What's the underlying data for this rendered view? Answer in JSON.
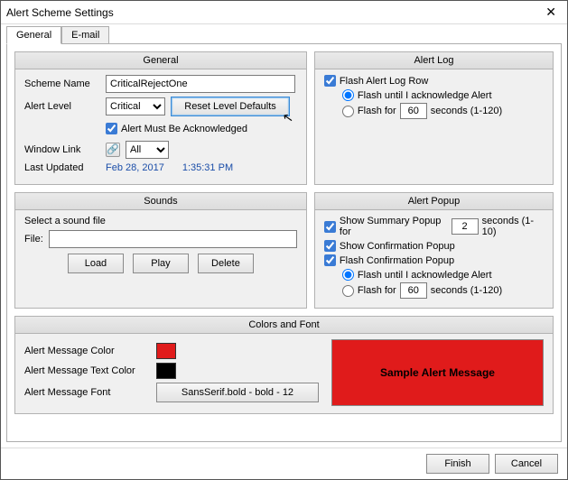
{
  "window": {
    "title": "Alert Scheme Settings"
  },
  "tabs": {
    "general": "General",
    "email": "E-mail"
  },
  "general": {
    "title": "General",
    "scheme_label": "Scheme Name",
    "scheme_value": "CriticalRejectOne",
    "level_label": "Alert Level",
    "level_value": "Critical",
    "reset_label": "Reset Level Defaults",
    "must_ack": "Alert Must Be Acknowledged",
    "window_link": "Window Link",
    "window_link_value": "All",
    "last_updated_label": "Last Updated",
    "last_updated_date": "Feb 28, 2017",
    "last_updated_time": "1:35:31 PM"
  },
  "alertlog": {
    "title": "Alert Log",
    "flash_row": "Flash Alert Log Row",
    "until_ack": "Flash until I acknowledge Alert",
    "flash_for_a": "Flash for",
    "flash_for_val": "60",
    "flash_for_b": "seconds (1-120)"
  },
  "sounds": {
    "title": "Sounds",
    "select": "Select a sound file",
    "file": "File:",
    "load": "Load",
    "play": "Play",
    "delete": "Delete"
  },
  "popup": {
    "title": "Alert Popup",
    "summary_a": "Show Summary Popup for",
    "summary_val": "2",
    "summary_b": "seconds (1-10)",
    "confirm": "Show Confirmation Popup",
    "flash_confirm": "Flash Confirmation Popup",
    "until_ack": "Flash until I acknowledge Alert",
    "flash_for_a": "Flash for",
    "flash_for_val": "60",
    "flash_for_b": "seconds (1-120)"
  },
  "colors": {
    "title": "Colors and Font",
    "msg_color": "Alert Message Color",
    "msg_text_color": "Alert Message Text Color",
    "font_label": "Alert Message Font",
    "font_value": "SansSerif.bold - bold - 12",
    "sample": "Sample Alert Message",
    "swatch_bg": "#e01b1b",
    "swatch_fg": "#000000"
  },
  "footer": {
    "finish": "Finish",
    "cancel": "Cancel"
  }
}
